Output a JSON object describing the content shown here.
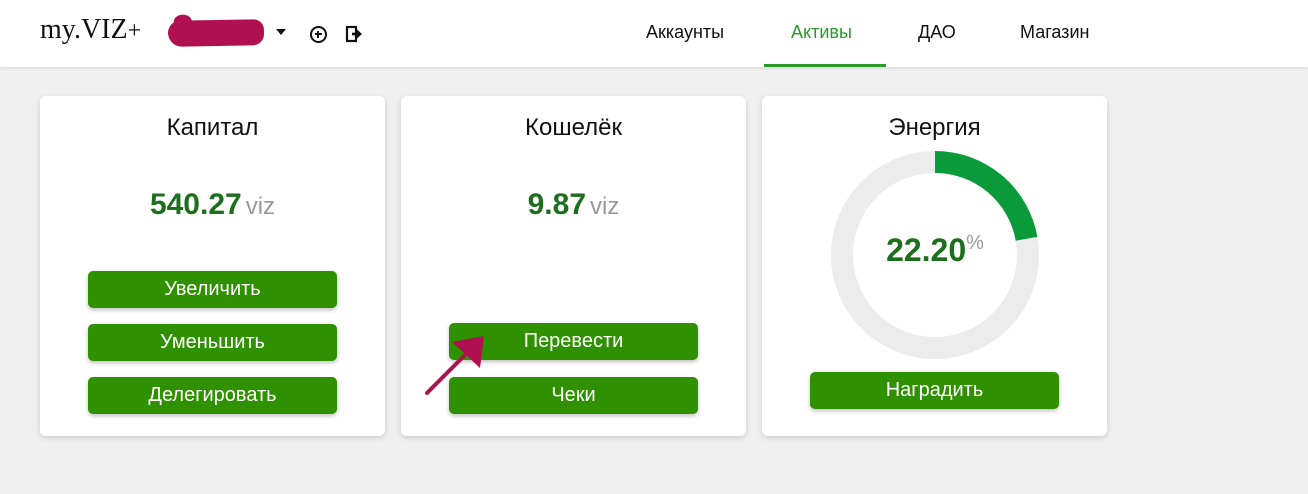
{
  "header": {
    "logo_main": "my.VIZ",
    "logo_plus": "+",
    "nav": [
      {
        "label": "Аккаунты"
      },
      {
        "label": "Активы",
        "active": true
      },
      {
        "label": "ДАО"
      },
      {
        "label": "Магазин"
      }
    ],
    "icons": [
      "plus-circle-icon",
      "logout-icon",
      "caret-down-icon"
    ],
    "accent_color": "#2a9a2a"
  },
  "cards": {
    "capital": {
      "title": "Капитал",
      "value": "540.27",
      "unit": "viz",
      "buttons": [
        "Увеличить",
        "Уменьшить",
        "Делегировать"
      ]
    },
    "wallet": {
      "title": "Кошелёк",
      "value": "9.87",
      "unit": "viz",
      "buttons": [
        "Перевести",
        "Чеки"
      ]
    },
    "energy": {
      "title": "Энергия",
      "value": "22.20",
      "unit": "%",
      "percent": 22.2,
      "buttons": [
        "Наградить"
      ]
    }
  },
  "colors": {
    "button": "#2f9100",
    "value_text": "#1d6e1d",
    "gauge_fill": "#0a9a3a",
    "gauge_track": "#ececec",
    "annotation_arrow": "#b0104f"
  }
}
